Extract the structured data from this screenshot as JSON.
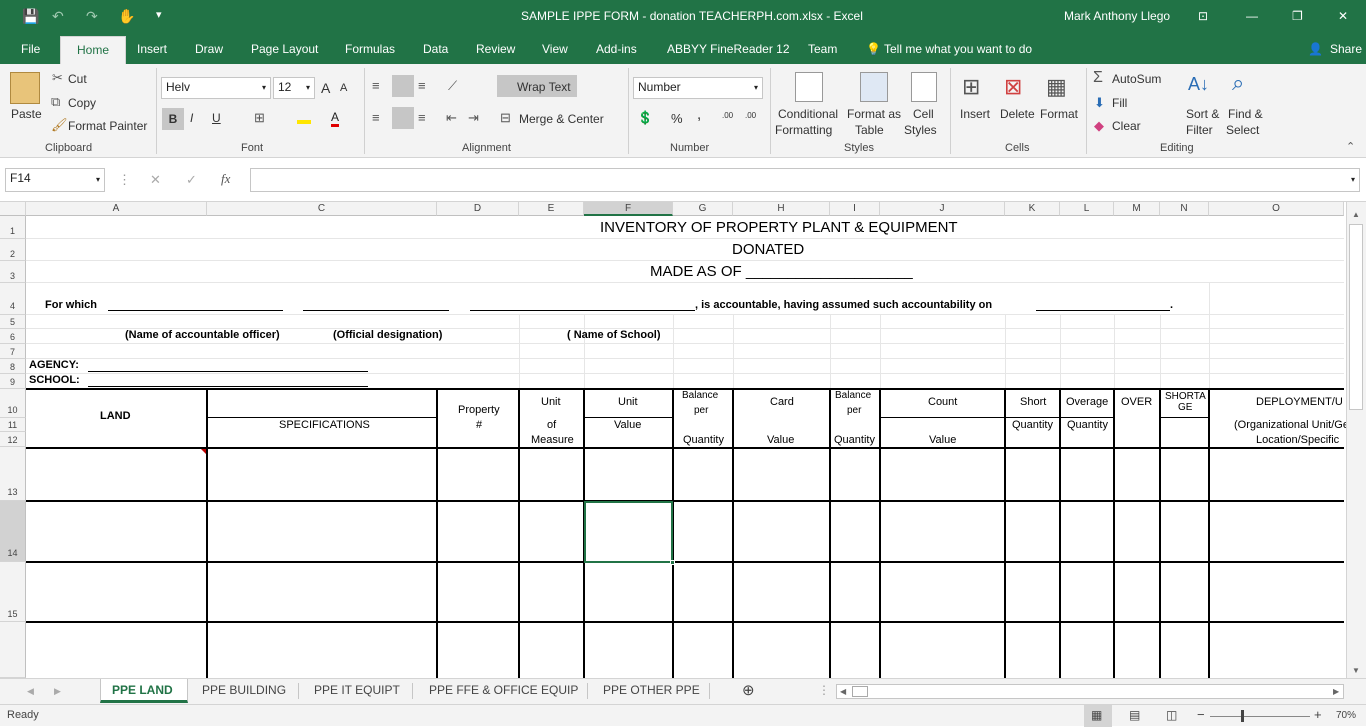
{
  "window": {
    "title": "SAMPLE IPPE FORM - donation TEACHERPH.com.xlsx - Excel",
    "user": "Mark Anthony Llego",
    "min": "—",
    "restore": "❐",
    "close": "✕",
    "display_options": "⊡"
  },
  "qat": {
    "save_icon": "💾",
    "undo_icon": "↶",
    "redo_icon": "↷",
    "touch_icon": "✋",
    "more_icon": "▾"
  },
  "ribbon_tabs": [
    "File",
    "Home",
    "Insert",
    "Draw",
    "Page Layout",
    "Formulas",
    "Data",
    "Review",
    "View",
    "Add-ins",
    "ABBYY FineReader 12",
    "Team"
  ],
  "tell_me": "Tell me what you want to do",
  "share": "Share",
  "clipboard": {
    "paste": "Paste",
    "cut": "Cut",
    "copy": "Copy",
    "format_painter": "Format Painter",
    "label": "Clipboard"
  },
  "font": {
    "name": "Helv",
    "size": "12",
    "bold": "B",
    "italic": "I",
    "underline": "U",
    "grow": "A",
    "shrink": "A",
    "font_color": "A",
    "label": "Font"
  },
  "alignment": {
    "wrap": "Wrap Text",
    "merge": "Merge & Center",
    "label": "Alignment"
  },
  "number": {
    "format": "Number",
    "percent": "%",
    "comma": ",",
    "inc": ".00",
    "dec": ".00",
    "label": "Number"
  },
  "styles": {
    "conditional": "Conditional",
    "formatting": "Formatting",
    "format_as": "Format as",
    "table": "Table",
    "cell": "Cell",
    "cell_styles": "Styles",
    "label": "Styles"
  },
  "cells": {
    "insert": "Insert",
    "delete": "Delete",
    "format": "Format",
    "label": "Cells"
  },
  "editing": {
    "autosum": "AutoSum",
    "fill": "Fill",
    "clear": "Clear",
    "sort": "Sort &",
    "filter": "Filter",
    "find": "Find &",
    "select": "Select",
    "label": "Editing"
  },
  "formula_bar": {
    "name_box": "F14",
    "fx": "fx",
    "cancel": "✕",
    "enter": "✓",
    "value": ""
  },
  "columns": [
    "A",
    "C",
    "D",
    "E",
    "F",
    "G",
    "H",
    "I",
    "J",
    "K",
    "L",
    "M",
    "N",
    "O"
  ],
  "rows": [
    "1",
    "2",
    "3",
    "4",
    "5",
    "6",
    "7",
    "8",
    "9",
    "10",
    "11",
    "12",
    "13",
    "14",
    "15"
  ],
  "sheet": {
    "title1": "INVENTORY OF PROPERTY PLANT & EQUIPMENT",
    "title2": "DONATED",
    "title3": "MADE AS OF ____________________",
    "for_which": "For which",
    "accountable": ", is accountable, having assumed such accountability on",
    "name_officer": "(Name of accountable officer)",
    "official": "(Official designation)",
    "school_name": "( Name of School)",
    "agency": "AGENCY:",
    "school": "SCHOOL:",
    "h_land": "LAND",
    "h_spec": "SPECIFICATIONS",
    "h_property": "Property",
    "h_hash": "#",
    "h_unit": "Unit",
    "h_of": "of",
    "h_measure": "Measure",
    "h_unit2": "Unit",
    "h_value": "Value",
    "h_balance": "Balance",
    "h_per": "per",
    "h_quantity": "Quantity",
    "h_card": "Card",
    "h_value2": "Value",
    "h_balance2": "Balance",
    "h_per2": "per",
    "h_quantity2": "Quantity",
    "h_count": "Count",
    "h_value3": "Value",
    "h_short": "Short",
    "h_quantity3": "Quantity",
    "h_overage": "Overage",
    "h_quantity4": "Quantity",
    "h_over": "OVER",
    "h_shorta": "SHORTA",
    "h_ge": "GE",
    "h_deploy": "DEPLOYMENT/U",
    "h_org": "(Organizational Unit/Ge",
    "h_loc": "Location/Specific"
  },
  "sheet_tabs": [
    "PPE LAND",
    "PPE BUILDING",
    "PPE IT EQUIPT",
    "PPE FFE & OFFICE EQUIP",
    "PPE OTHER PPE"
  ],
  "status": {
    "ready": "Ready",
    "zoom": "70%",
    "plus": "+",
    "minus": "−"
  }
}
